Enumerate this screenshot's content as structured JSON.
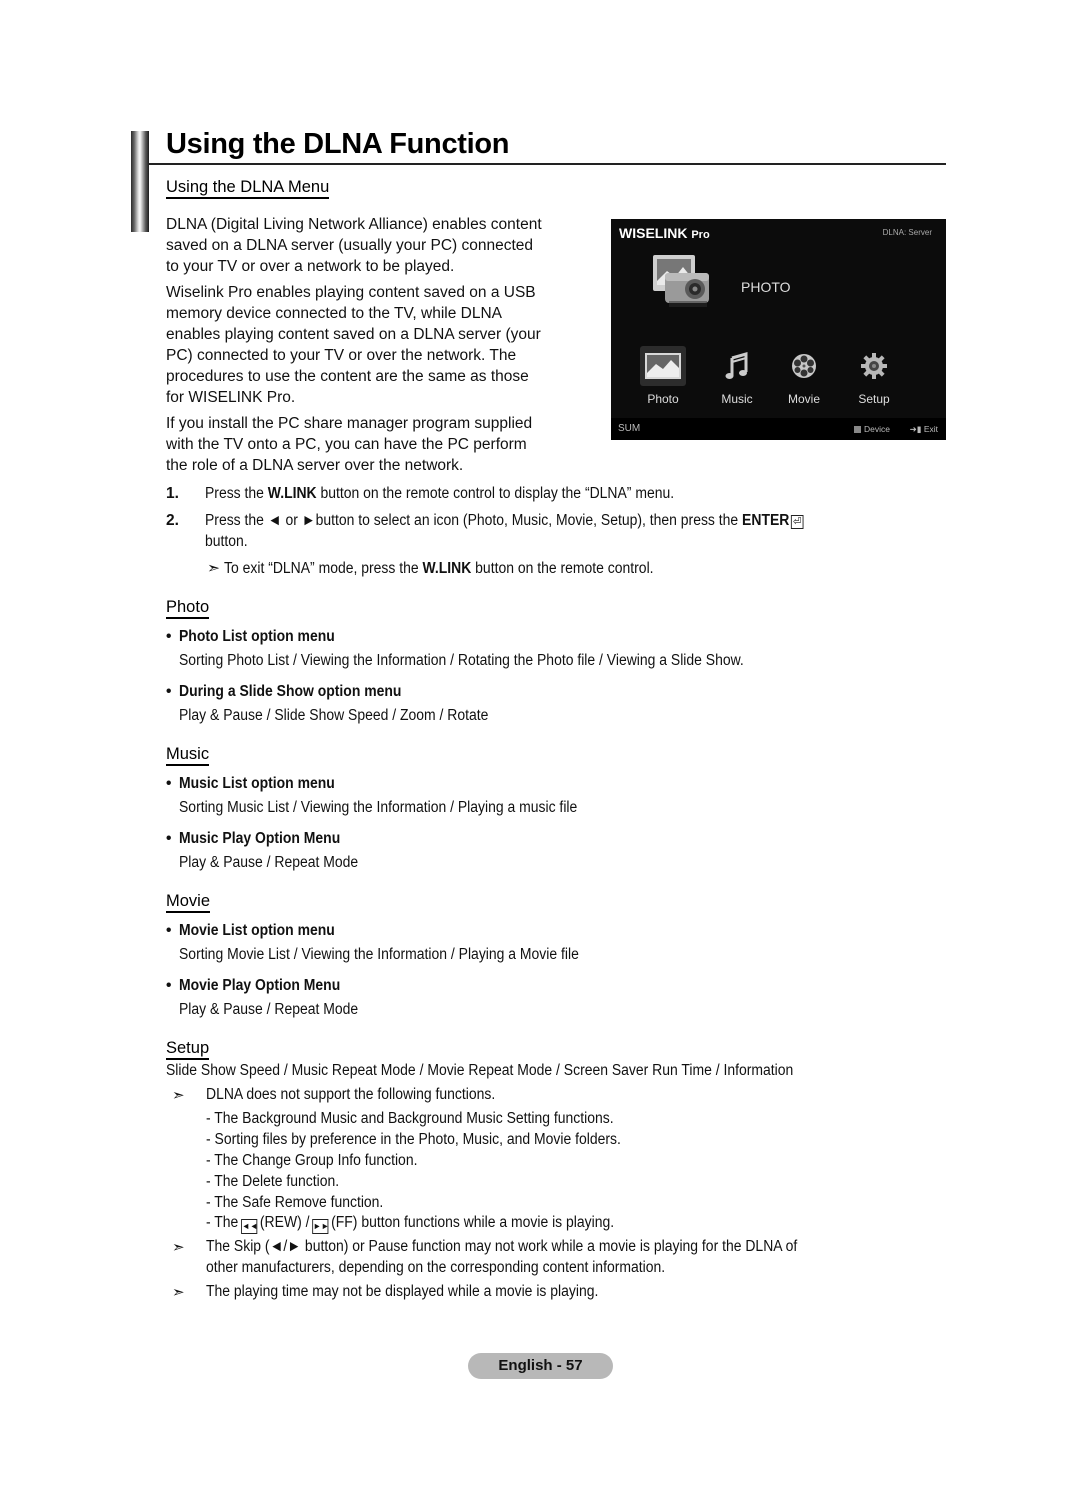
{
  "page": {
    "title": "Using the DLNA Function",
    "footer_badge": "English - 57"
  },
  "menu_section": {
    "heading": "Using the DLNA Menu",
    "paragraphs": [
      [
        "DLNA (Digital Living Network Alliance) enables content",
        "saved on a DLNA server (usually your PC) connected",
        "to your TV or over a network to be played."
      ],
      [
        "Wiselink Pro enables playing content saved on a USB",
        "memory device connected to the TV, while DLNA",
        "enables playing content saved on a DLNA server (your",
        "PC) connected to your TV or over the network. The",
        "procedures to use the content are the same as those",
        "for WISELINK Pro."
      ],
      [
        "If you install the PC share manager program supplied",
        "with the TV onto a PC, you can have the PC perform",
        "the role of a DLNA server over the network."
      ]
    ],
    "steps": [
      {
        "num": "1.",
        "pre": "Press the ",
        "bold": "W.LINK",
        "post": " button on the remote control to display the “DLNA” menu."
      },
      {
        "num": "2.",
        "pre": "Press the ◄ or ►button to select an icon (Photo, Music, Movie, Setup), then press the ",
        "bold": "ENTER",
        "enter_icon": "⏎",
        "line2": "button."
      }
    ],
    "note": {
      "arrow": "➣",
      "pre": "To exit “DLNA” mode, press the ",
      "bold": "W.LINK",
      "post": " button on the remote control."
    }
  },
  "tv_screen": {
    "brand": "WISELINK",
    "brand_suffix": "Pro",
    "server_label": "DLNA: Server",
    "hero_label": "PHOTO",
    "menu_items": [
      {
        "label": "Photo",
        "icon": "photo-icon",
        "active": true
      },
      {
        "label": "Music",
        "icon": "music-note-icon",
        "active": false
      },
      {
        "label": "Movie",
        "icon": "film-reel-icon",
        "active": false
      },
      {
        "label": "Setup",
        "icon": "gear-icon",
        "active": false
      }
    ],
    "footer": {
      "left": "SUM",
      "device": "Device",
      "exit": "Exit"
    }
  },
  "photo_section": {
    "heading": "Photo",
    "bullets": [
      {
        "title": "Photo List option menu",
        "body": "Sorting Photo List / Viewing the Information / Rotating the Photo file / Viewing a Slide Show."
      },
      {
        "title": "During a Slide Show option menu",
        "body": "Play & Pause / Slide Show Speed / Zoom / Rotate"
      }
    ]
  },
  "music_section": {
    "heading": "Music",
    "bullets": [
      {
        "title": "Music List option menu",
        "body": "Sorting Music List / Viewing the Information / Playing a music file"
      },
      {
        "title": "Music Play Option Menu",
        "body": "Play & Pause / Repeat Mode"
      }
    ]
  },
  "movie_section": {
    "heading": "Movie",
    "bullets": [
      {
        "title": "Movie List option menu",
        "body": "Sorting Movie List / Viewing the Information / Playing a Movie file"
      },
      {
        "title": "Movie Play Option Menu",
        "body": "Play & Pause / Repeat Mode"
      }
    ]
  },
  "setup_section": {
    "heading": "Setup",
    "body": "Slide Show Speed / Music Repeat Mode / Movie Repeat Mode / Screen Saver Run Time / Information",
    "notes": [
      {
        "text": "DLNA does not support the following functions.",
        "sub": [
          "- The Background Music and Background Music Setting functions.",
          "- Sorting files by preference in the Photo, Music, and Movie folders.",
          "- The Change Group Info function.",
          "- The Delete function.",
          "- The Safe Remove function."
        ],
        "rew_line": {
          "pre": "- The",
          "rew_icon": "◄◄",
          "mid": "(REW) /",
          "ff_icon": "►►",
          "post": "(FF) button functions while a movie is playing."
        }
      },
      {
        "lines": [
          "The Skip (◄/► button) or Pause function may not work while a movie is playing for the DLNA of",
          "other manufacturers, depending on the corresponding content information."
        ]
      },
      {
        "text": "The playing time may not be displayed while a movie is playing."
      }
    ],
    "arrow": "➣"
  }
}
